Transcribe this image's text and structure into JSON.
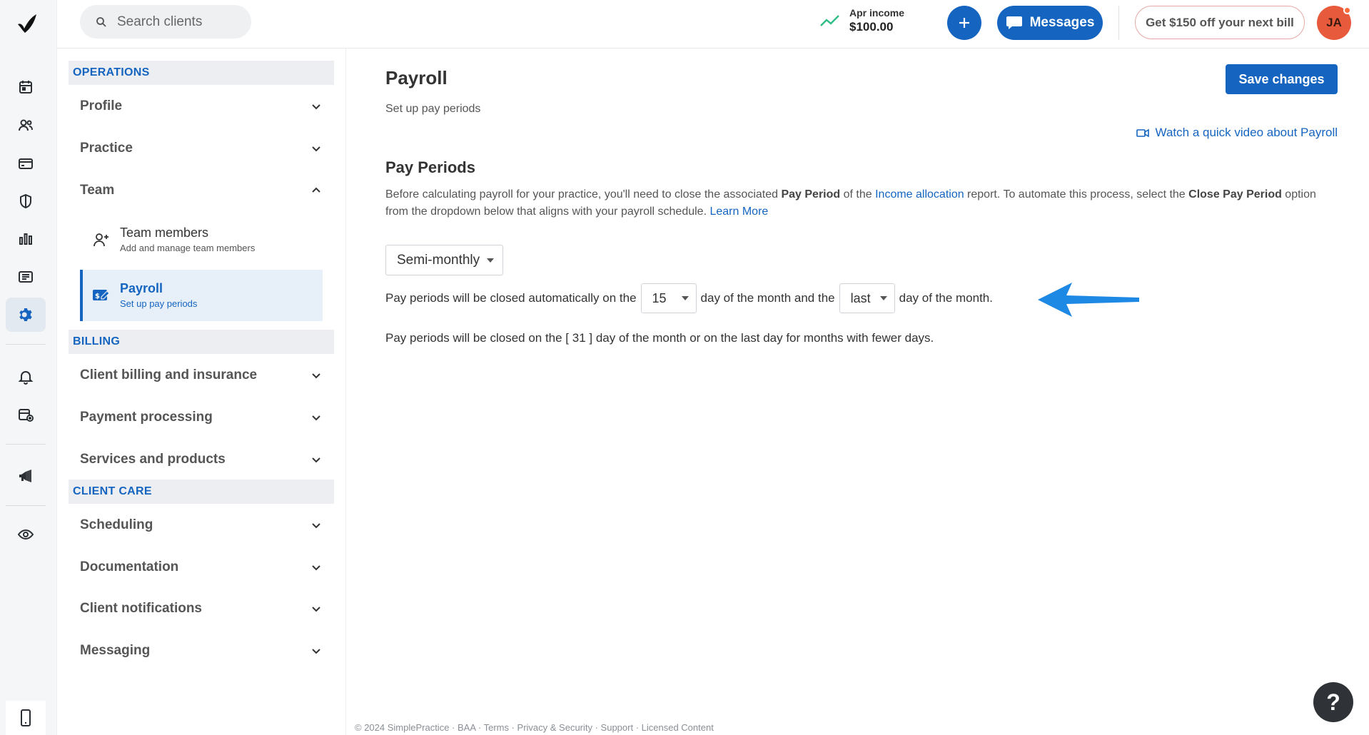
{
  "rail": {
    "items": [
      "calendar-icon",
      "clients-icon",
      "billing-card-icon",
      "insurance-shield-icon",
      "analytics-icon",
      "activity-list-icon",
      "settings-gear-icon",
      "notifications-bell-icon",
      "requests-calendar-icon",
      "announcements-megaphone-icon",
      "preview-eye-icon",
      "mobile-app-icon"
    ],
    "active": "settings-gear-icon"
  },
  "topbar": {
    "search_placeholder": "Search clients",
    "income_label": "Apr income",
    "income_value": "$100.00",
    "messages_label": "Messages",
    "promo_label": "Get $150 off your next bill",
    "avatar_initials": "JA"
  },
  "sidebar": {
    "operations_header": "OPERATIONS",
    "profile": "Profile",
    "practice": "Practice",
    "team": "Team",
    "team_members_title": "Team members",
    "team_members_sub": "Add and manage team members",
    "payroll_title": "Payroll",
    "payroll_sub": "Set up pay periods",
    "billing_header": "BILLING",
    "client_billing": "Client billing and insurance",
    "payment_processing": "Payment processing",
    "services_products": "Services and products",
    "client_care_header": "CLIENT CARE",
    "scheduling": "Scheduling",
    "documentation": "Documentation",
    "client_notifications": "Client notifications",
    "messaging": "Messaging"
  },
  "main": {
    "title": "Payroll",
    "subtitle": "Set up pay periods",
    "save_label": "Save changes",
    "video_link": "Watch a quick video about Payroll",
    "section_title": "Pay Periods",
    "desc_1": "Before calculating payroll for your practice, you'll need to close the associated ",
    "desc_b1": "Pay Period",
    "desc_2": " of the ",
    "desc_link1": "Income allocation",
    "desc_3": " report. To automate this process, select the ",
    "desc_b2": "Close Pay Period",
    "desc_4": " option from the dropdown below that aligns with your payroll schedule. ",
    "desc_link2": "Learn More",
    "frequency_value": "Semi-monthly",
    "rule_prefix": "Pay periods will be closed automatically on the",
    "first_day": "15",
    "rule_mid": "day of the month and the",
    "second_day": "last",
    "rule_suffix": "day of the month.",
    "note": "Pay periods will be closed on the [ 31 ] day of the month or on the last day for months with fewer days."
  },
  "footer": "© 2024 SimplePractice · BAA · Terms · Privacy & Security · Support · Licensed Content",
  "colors": {
    "brand_blue": "#1565c0",
    "annotation_arrow": "#1e88e5"
  }
}
